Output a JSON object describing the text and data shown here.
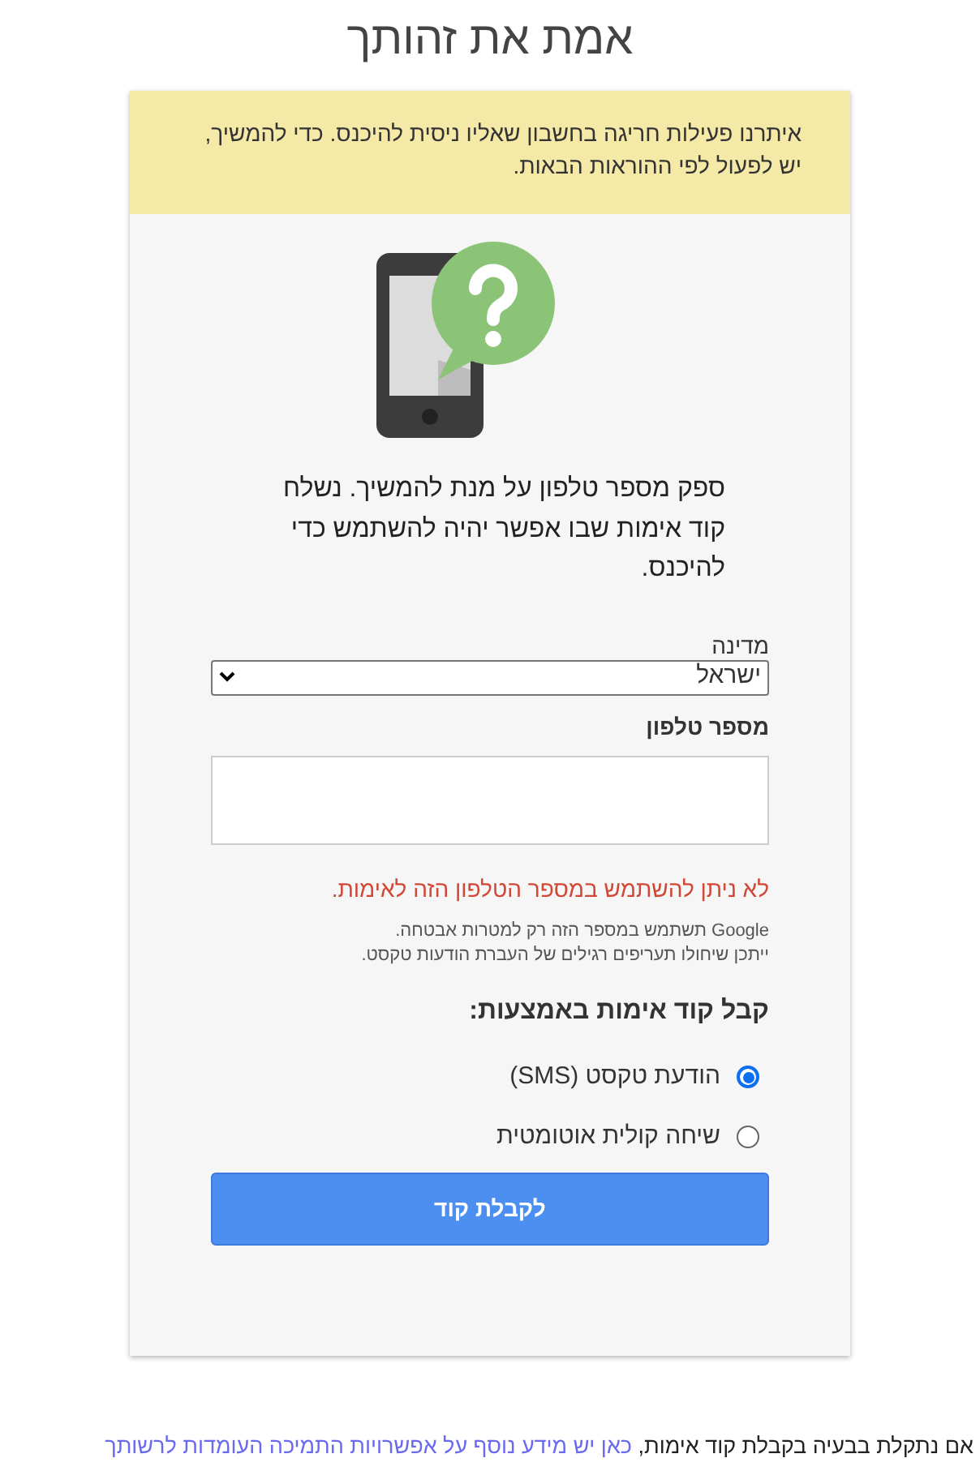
{
  "title": "אמת את זהותך",
  "alert": {
    "text": "איתרנו פעילות חריגה בחשבון שאליו ניסית להיכנס. כדי להמשיך, יש לפעול לפי ההוראות הבאות."
  },
  "instructions": "ספק מספר טלפון על מנת להמשיך. נשלח קוד אימות שבו אפשר יהיה להשתמש כדי להיכנס.",
  "country": {
    "label": "מדינה",
    "value": "ישראל"
  },
  "phone": {
    "label": "מספר טלפון"
  },
  "error": "לא ניתן להשתמש במספר הטלפון הזה לאימות.",
  "notes": [
    "Google תשתמש במספר הזה רק למטרות אבטחה.",
    "ייתכן שיחולו תעריפים רגילים של העברת הודעות טקסט."
  ],
  "method": {
    "label": "קבל קוד אימות באמצעות:",
    "options": [
      {
        "label": "הודעת טקסט (SMS)",
        "selected": true
      },
      {
        "label": "שיחה קולית אוטומטית",
        "selected": false
      }
    ]
  },
  "submit": "לקבלת קוד",
  "footer": {
    "text": "אם נתקלת בבעיה בקבלת קוד אימות,",
    "link": "כאן יש מידע נוסף על אפשרויות התמיכה העומדות לרשותך"
  }
}
